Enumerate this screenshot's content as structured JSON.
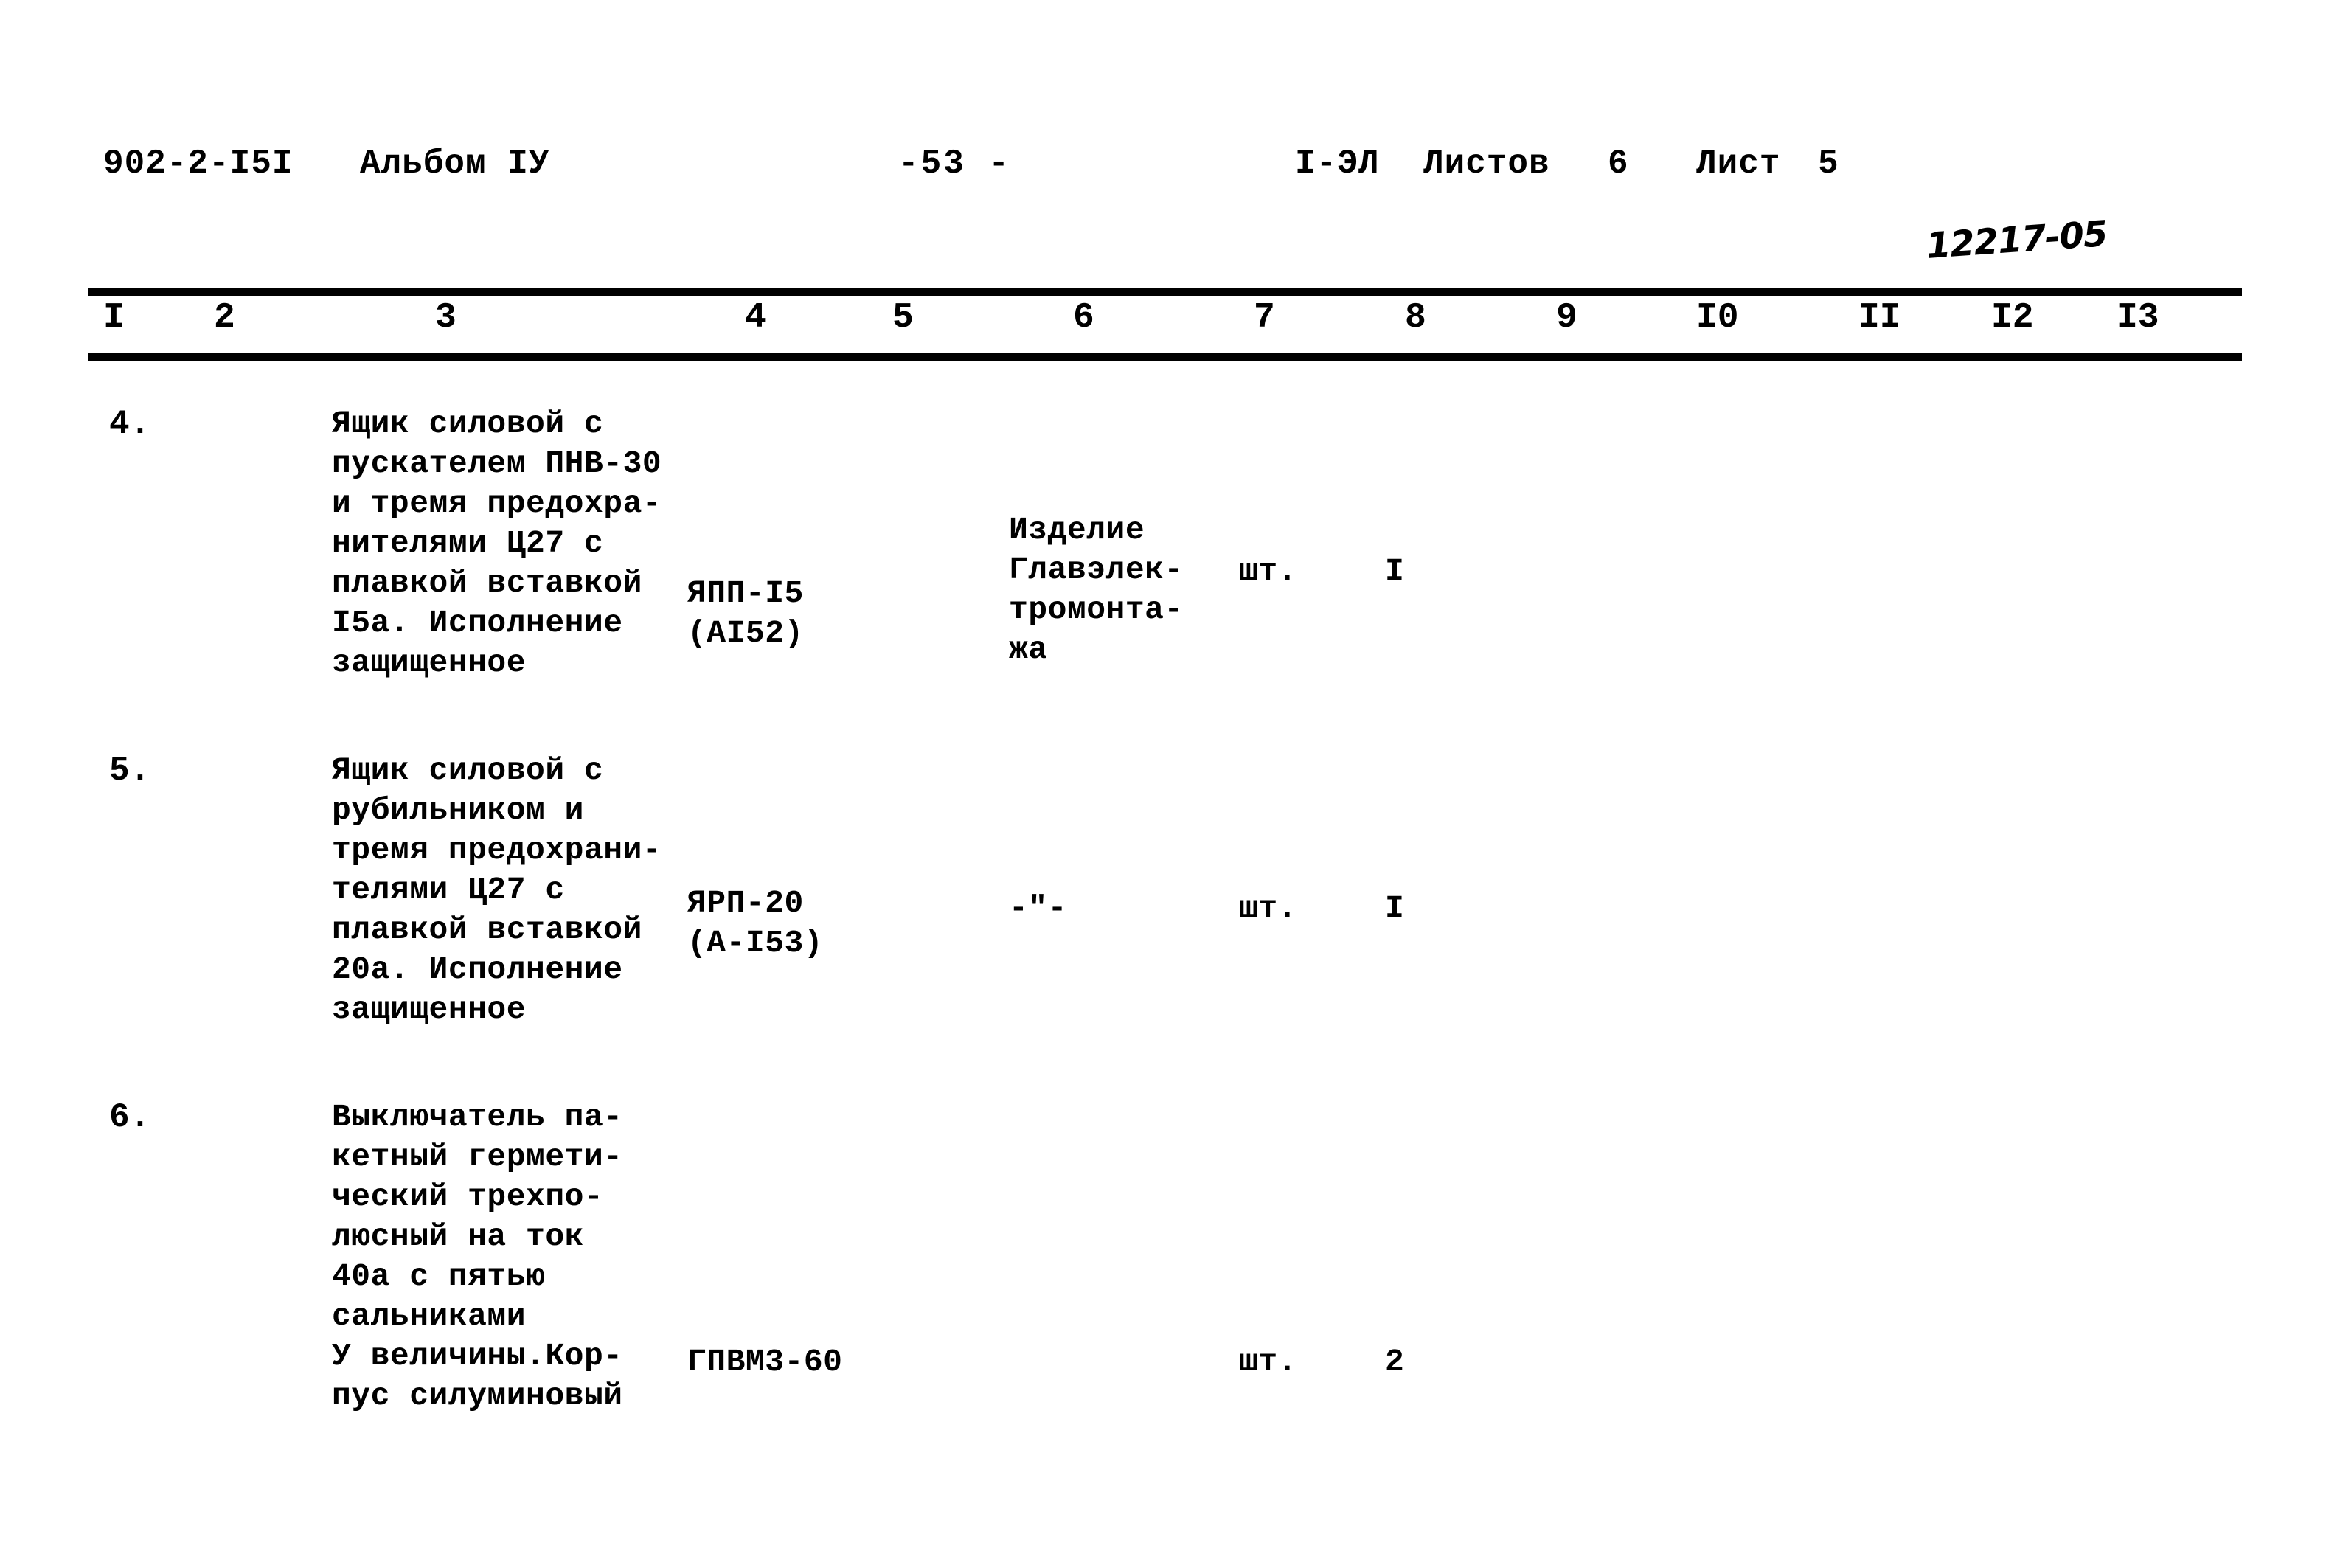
{
  "header": {
    "doc_code": "902-2-I5I",
    "album": "Альбом IУ",
    "page_number": "-53 -",
    "sheet_code": "I-ЭЛ",
    "sheets_label": "Листов",
    "sheets_count": "6",
    "sheet_label": "Лист",
    "sheet_number": "5",
    "handwritten_note": "12217-05"
  },
  "column_numbers": [
    "I",
    "2",
    "3",
    "4",
    "5",
    "6",
    "7",
    "8",
    "9",
    "I0",
    "II",
    "I2",
    "I3"
  ],
  "rows": [
    {
      "num": "4.",
      "description": "Ящик силовой с\nпускателем ПНВ-30\nи тремя предохра-\nнителями Ц27 с\nплавкой вставкой\nI5а. Исполнение\nзащищенное",
      "type": "ЯПП-I5\n(АI52)",
      "maker": "Изделие\nГлавэлек-\nтромонта-\nжа",
      "unit": "шт.",
      "qty": "I"
    },
    {
      "num": "5.",
      "description": "Ящик силовой с\nрубильником и\nтремя предохрани-\nтелями Ц27 с\nплавкой вставкой\n20а. Исполнение\nзащищенное",
      "type": "ЯРП-20\n(А-I53)",
      "maker": "-\"-",
      "unit": "шт.",
      "qty": "I"
    },
    {
      "num": "6.",
      "description": "Выключатель па-\nкетный гермети-\nческий трехпо-\nлюсный на ток\n40а с пятью\nсальниками\nУ величины.Кор-\nпус силуминовый",
      "type": "ГПВМ3-60",
      "maker": "",
      "unit": "шт.",
      "qty": "2"
    }
  ]
}
